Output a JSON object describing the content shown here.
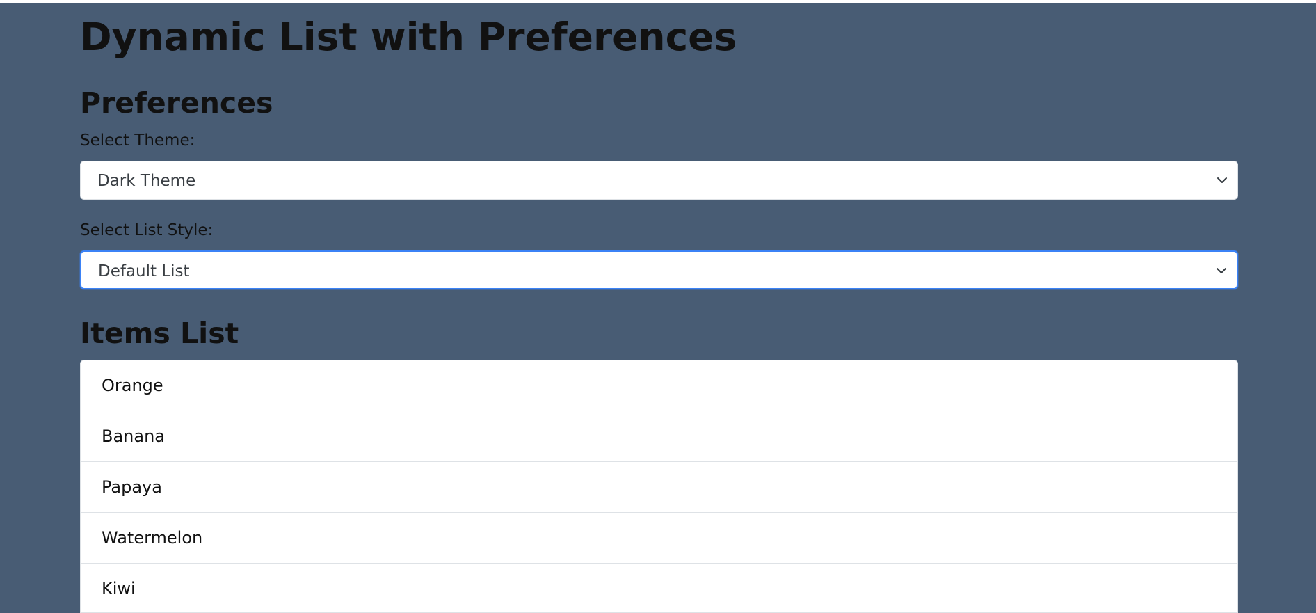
{
  "page": {
    "title": "Dynamic List with Preferences"
  },
  "preferences": {
    "heading": "Preferences",
    "theme": {
      "label": "Select Theme:",
      "selected": "Dark Theme"
    },
    "list_style": {
      "label": "Select List Style:",
      "selected": "Default List"
    }
  },
  "items_list": {
    "heading": "Items List",
    "items": [
      "Orange",
      "Banana",
      "Papaya",
      "Watermelon",
      "Kiwi"
    ]
  },
  "colors": {
    "background": "#485c74",
    "surface": "#ffffff",
    "focus_ring": "#3b82f6",
    "text": "#111111"
  },
  "icons": {
    "select_chevron": "chevron-down-icon"
  }
}
